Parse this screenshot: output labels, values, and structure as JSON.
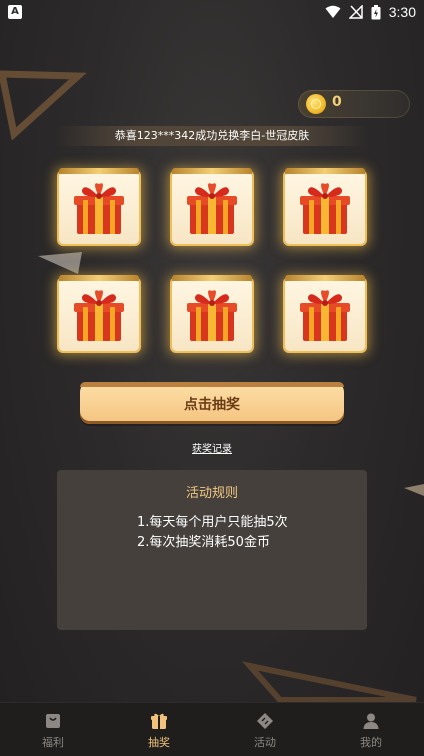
{
  "status_bar": {
    "time": "3:30",
    "left_icon": "A"
  },
  "coins": {
    "value": "0",
    "icon": "coin-icon"
  },
  "marquee": {
    "text": "恭喜123***342成功兑换李白-世冠皮肤"
  },
  "gifts": [
    {
      "icon": "gift-box-icon"
    },
    {
      "icon": "gift-box-icon"
    },
    {
      "icon": "gift-box-icon"
    },
    {
      "icon": "gift-box-icon"
    },
    {
      "icon": "gift-box-icon"
    },
    {
      "icon": "gift-box-icon"
    }
  ],
  "draw_button": {
    "label": "点击抽奖"
  },
  "record_link": {
    "label": "获奖记录"
  },
  "rules": {
    "title": "活动规则",
    "lines": [
      "1.每天每个用户只能抽5次",
      "2.每次抽奖消耗50金币"
    ]
  },
  "nav": {
    "items": [
      {
        "label": "福利",
        "icon": "bag-icon",
        "active": false
      },
      {
        "label": "抽奖",
        "icon": "gift-icon",
        "active": true
      },
      {
        "label": "活动",
        "icon": "ticket-icon",
        "active": false
      },
      {
        "label": "我的",
        "icon": "person-icon",
        "active": false
      }
    ]
  },
  "colors": {
    "accent": "#f2c27c",
    "button": "#f4c37f",
    "background": "#2c2a2a",
    "panel": "#45403c"
  }
}
